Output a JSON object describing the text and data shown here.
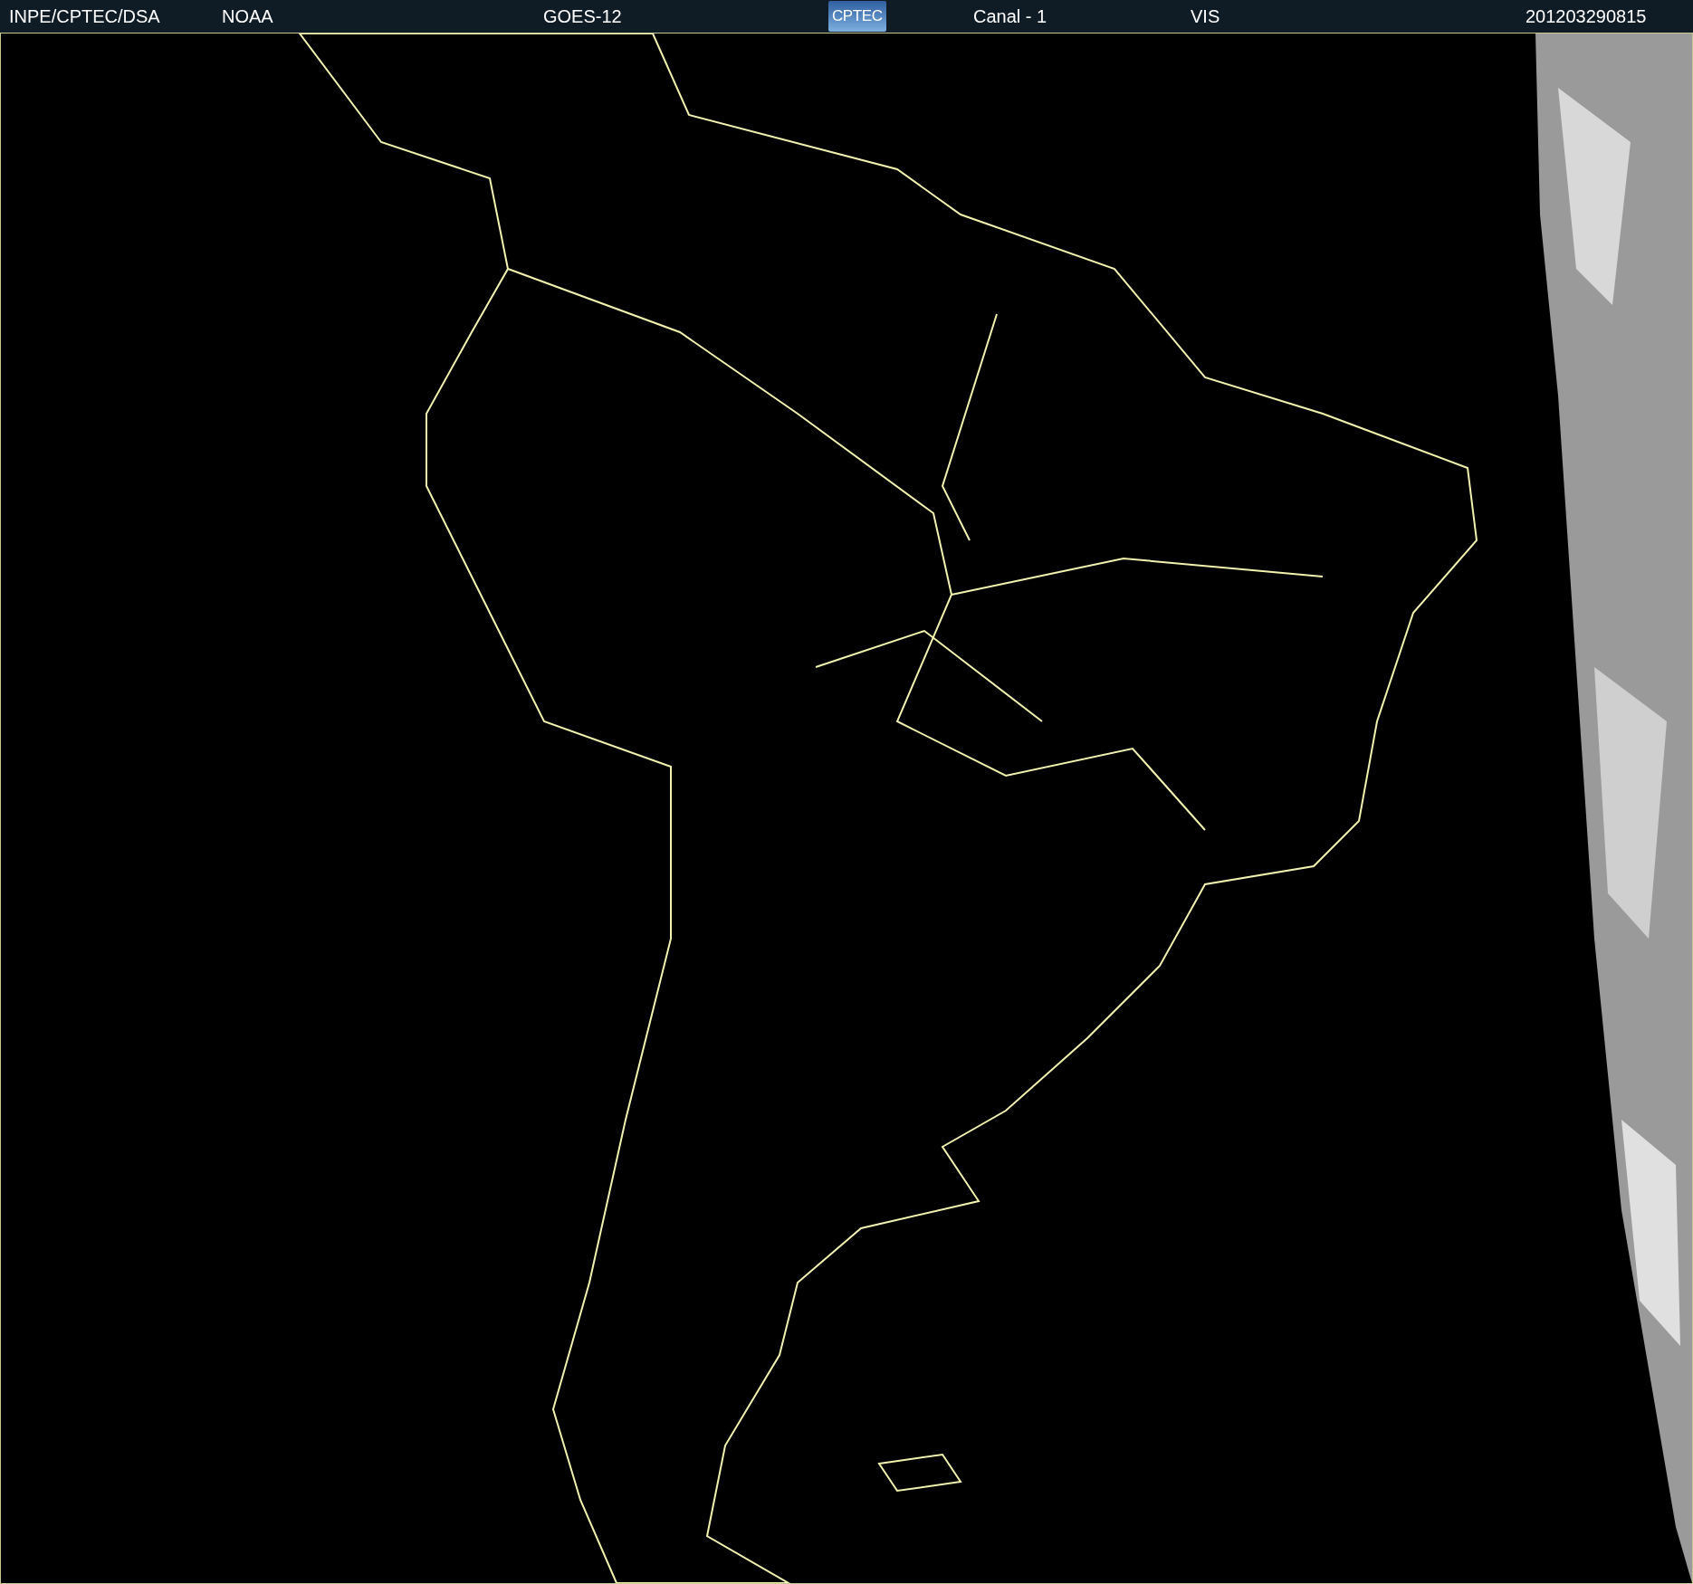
{
  "header": {
    "items": [
      {
        "kind": "text",
        "label": "INPE/CPTEC/DSA"
      },
      {
        "kind": "text",
        "label": "NOAA"
      },
      {
        "kind": "text",
        "label": "GOES-12"
      },
      {
        "kind": "logo",
        "label": "CPTEC"
      },
      {
        "kind": "text",
        "label": "Canal - 1"
      },
      {
        "kind": "text",
        "label": "VIS"
      },
      {
        "kind": "text",
        "label": "201203290815"
      }
    ]
  }
}
